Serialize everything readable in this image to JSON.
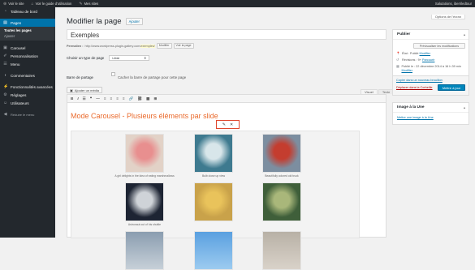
{
  "admin_bar": {
    "items": [
      {
        "icon": "wordpress-icon",
        "label": "Voir le site"
      },
      {
        "icon": "house-icon",
        "label": "Voir le guide d'utilisation"
      },
      {
        "icon": "pin-icon",
        "label": "Mes sites"
      }
    ],
    "greeting": "Salutations, iberriledtour"
  },
  "sidebar": {
    "dashboard": "Tableau de bord",
    "pages": "Pages",
    "pages_sub": [
      "Toutes les pages",
      "Ajouter"
    ],
    "items": [
      {
        "label": "Carousel",
        "icon": "gallery-icon"
      },
      {
        "label": "Personnalisation",
        "icon": "brush-icon"
      },
      {
        "label": "Menu",
        "icon": "menu-icon"
      },
      {
        "label": "Commentaires",
        "icon": "comment-icon"
      },
      {
        "label": "Fonctionnalités avancées",
        "icon": "plugin-icon"
      },
      {
        "label": "Réglages",
        "icon": "settings-icon"
      },
      {
        "label": "Utilisateurs",
        "icon": "users-icon"
      }
    ],
    "collapse": "Réduire le menu"
  },
  "header": {
    "title": "Modifier la page",
    "add_button": "Ajouter",
    "screen_options": "Options de l'écran"
  },
  "post": {
    "title": "Exemples",
    "permalink_label": "Permalien :",
    "permalink_base": "http://www.wordpress-plugin-gallery.com/",
    "permalink_slug": "exemples/",
    "edit_button": "Modifier",
    "view_button": "Voir la page",
    "page_type_label": "Choisir un type de page",
    "page_type_value": "Libre",
    "share_label": "Barre de partage",
    "share_checkbox": "Cacher la barre de partage pour cette page"
  },
  "editor": {
    "add_media": "Ajouter un média",
    "tab_visual": "Visuel",
    "tab_text": "Texte",
    "toolbar": [
      "B",
      "I",
      "☰",
      "❝",
      "—",
      "≡",
      "≡",
      "≡",
      "≡",
      "🔗",
      "⛓",
      "▦",
      "⊞"
    ],
    "content_title": "Mode Carousel - Plusieurs éléments par slide",
    "gallery_edit_icon": "pencil-icon",
    "gallery_remove_icon": "close-icon",
    "gallery": [
      {
        "caption": "A girl delights in the idea of eating marshmallows",
        "colors": [
          "#e2d2c7",
          "#e88f8f"
        ]
      },
      {
        "caption": "Bulb close up view",
        "colors": [
          "#3e7a8f",
          "#d8e6ea"
        ]
      },
      {
        "caption": "Beautifully colored old truck",
        "colors": [
          "#7c8ea0",
          "#c43d2f"
        ]
      },
      {
        "caption": "Astronaut out of his shuttle",
        "colors": [
          "#1d2433",
          "#cfd3d8"
        ]
      },
      {
        "caption": "",
        "colors": [
          "#c9a24a",
          "#e9c35b"
        ]
      },
      {
        "caption": "",
        "colors": [
          "#3f5f3a",
          "#a9b77a"
        ]
      }
    ]
  },
  "publish": {
    "title": "Publier",
    "preview": "Prévisualiser les modifications",
    "status_label": "État : Publié",
    "status_link": "Modifier",
    "revisions_label": "Révisions : 9+",
    "revisions_link": "Parcourir",
    "published_label": "Publié le : 22 décembre 2014 à 16 h 39 min",
    "published_link": "Modifier",
    "copy_draft": "Copier dans un nouveau brouillon",
    "trash": "Déplacer dans la Corbeille",
    "update": "Mettre à jour"
  },
  "featured": {
    "title": "Image à la Une",
    "link": "Mettre une image à la Une"
  }
}
